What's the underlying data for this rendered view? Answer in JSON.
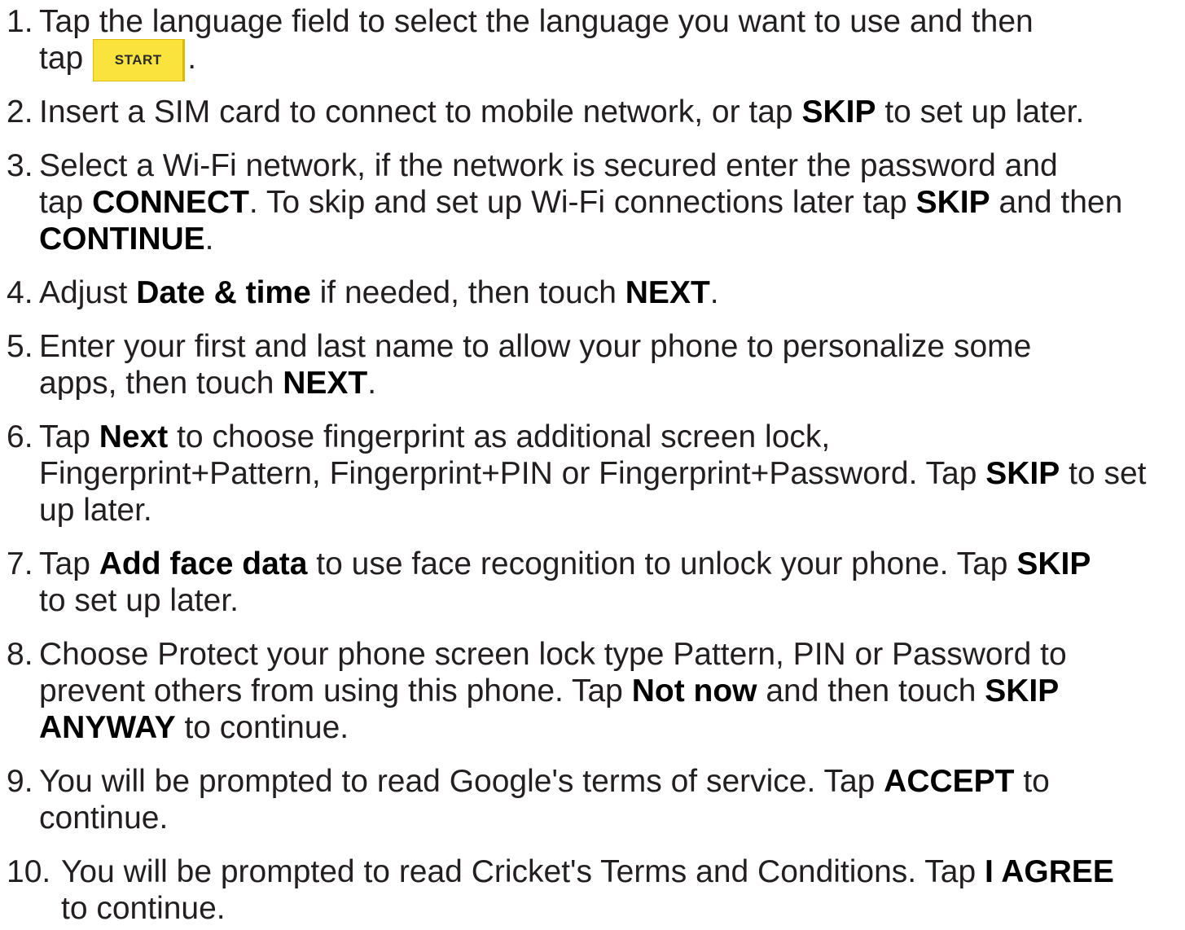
{
  "steps": [
    {
      "number": "1.",
      "lines": [
        [
          "Tap the language field to select the language you want to use and then"
        ],
        [
          "tap",
          "."
        ]
      ],
      "button_label": "START"
    },
    {
      "number": "2.",
      "lines": [
        [
          "Insert a SIM card to connect to mobile network, or tap ",
          "SKIP",
          " to set up later."
        ]
      ]
    },
    {
      "number": "3.",
      "lines": [
        [
          "Select a Wi-Fi network, if the network is secured enter the password and"
        ],
        [
          "tap ",
          "CONNECT",
          ". To skip and set up Wi-Fi connections later tap ",
          "SKIP",
          " and then"
        ],
        [
          "CONTINUE",
          "."
        ]
      ]
    },
    {
      "number": "4.",
      "lines": [
        [
          "Adjust ",
          "Date & time",
          " if needed, then touch ",
          "NEXT",
          "."
        ]
      ]
    },
    {
      "number": "5.",
      "lines": [
        [
          "Enter your first and last name to allow your phone to personalize some"
        ],
        [
          "apps, then touch ",
          "NEXT",
          "."
        ]
      ]
    },
    {
      "number": "6.",
      "lines": [
        [
          "Tap ",
          "Next",
          " to choose fingerprint as additional screen lock,"
        ],
        [
          "Fingerprint+Pattern, Fingerprint+PIN or Fingerprint+Password. Tap ",
          "SKIP",
          " to set"
        ],
        [
          "up later."
        ]
      ]
    },
    {
      "number": "7.",
      "lines": [
        [
          "Tap ",
          "Add face data",
          " to use face recognition to unlock your phone. Tap ",
          "SKIP"
        ],
        [
          "to set up later."
        ]
      ]
    },
    {
      "number": "8.",
      "lines": [
        [
          "Choose Protect your phone screen lock type Pattern, PIN or Password to"
        ],
        [
          "prevent others from using this phone. Tap ",
          "Not now",
          " and then touch ",
          "SKIP"
        ],
        [
          "ANYWAY",
          " to continue."
        ]
      ]
    },
    {
      "number": "9.",
      "lines": [
        [
          "You will be prompted to read Google's terms of service. Tap ",
          "ACCEPT",
          " to"
        ],
        [
          "continue."
        ]
      ]
    },
    {
      "number": "10.",
      "lines": [
        [
          "You will be prompted to read Cricket's Terms and Conditions. Tap ",
          "I AGREE"
        ],
        [
          "to continue."
        ]
      ]
    }
  ],
  "colors": {
    "text": "#231f20",
    "button_fill": "#f9e33c",
    "button_border": "#dcbb10"
  }
}
